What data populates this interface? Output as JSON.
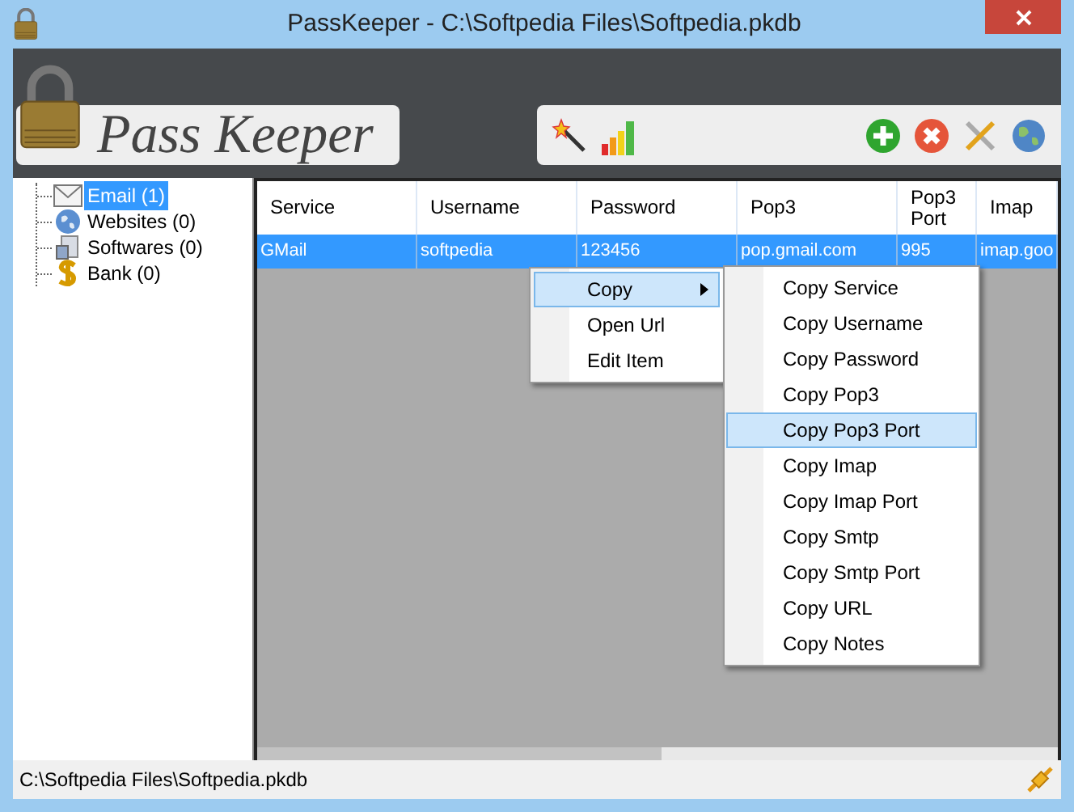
{
  "window": {
    "title": "PassKeeper - C:\\Softpedia Files\\Softpedia.pkdb"
  },
  "logo": {
    "text": "Pass Keeper"
  },
  "tree": {
    "items": [
      {
        "label": "Email (1)",
        "kind": "mail",
        "selected": true
      },
      {
        "label": "Websites (0)",
        "kind": "web",
        "selected": false
      },
      {
        "label": "Softwares (0)",
        "kind": "software",
        "selected": false
      },
      {
        "label": "Bank (0)",
        "kind": "bank",
        "selected": false
      }
    ]
  },
  "table": {
    "columns": [
      "Service",
      "Username",
      "Password",
      "Pop3",
      "Pop3 Port",
      "Imap"
    ],
    "rows": [
      {
        "cells": [
          "GMail",
          "softpedia",
          "123456",
          "pop.gmail.com",
          "995",
          "imap.goo"
        ],
        "selected": true
      }
    ]
  },
  "context_menu": {
    "items": [
      {
        "label": "Copy",
        "submenu": true,
        "selected": true
      },
      {
        "label": "Open Url",
        "submenu": false,
        "selected": false
      },
      {
        "label": "Edit Item",
        "submenu": false,
        "selected": false
      }
    ]
  },
  "submenu": {
    "items": [
      {
        "label": "Copy Service",
        "selected": false
      },
      {
        "label": "Copy Username",
        "selected": false
      },
      {
        "label": "Copy Password",
        "selected": false
      },
      {
        "label": "Copy Pop3",
        "selected": false
      },
      {
        "label": "Copy Pop3 Port",
        "selected": true
      },
      {
        "label": "Copy Imap",
        "selected": false
      },
      {
        "label": "Copy Imap Port",
        "selected": false
      },
      {
        "label": "Copy Smtp",
        "selected": false
      },
      {
        "label": "Copy Smtp Port",
        "selected": false
      },
      {
        "label": "Copy URL",
        "selected": false
      },
      {
        "label": "Copy Notes",
        "selected": false
      }
    ]
  },
  "status_bar": {
    "path": "C:\\Softpedia Files\\Softpedia.pkdb"
  }
}
